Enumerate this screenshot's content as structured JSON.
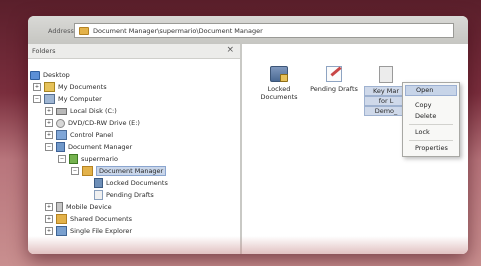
{
  "address_bar": {
    "label": "Address",
    "path": "Document Manager\\supermario\\Document Manager"
  },
  "folders_pane": {
    "title": "Folders",
    "close_glyph": "×"
  },
  "tree": [
    {
      "label": "Desktop",
      "icon": "desktop-icon",
      "expander": ""
    },
    {
      "label": "My Documents",
      "icon": "folder-icon",
      "expander": "+"
    },
    {
      "label": "My Computer",
      "icon": "computer-icon",
      "expander": "−"
    },
    {
      "label": "Local Disk (C:)",
      "icon": "disk-icon",
      "expander": "+"
    },
    {
      "label": "DVD/CD-RW Drive (E:)",
      "icon": "cd-drive-icon",
      "expander": "+"
    },
    {
      "label": "Control Panel",
      "icon": "control-panel-icon",
      "expander": "+"
    },
    {
      "label": "Document Manager",
      "icon": "document-manager-icon",
      "expander": "−"
    },
    {
      "label": "supermario",
      "icon": "user-icon",
      "expander": "−"
    },
    {
      "label": "Document Manager",
      "icon": "folder-icon",
      "expander": "−",
      "selected": true
    },
    {
      "label": "Locked Documents",
      "icon": "locked-documents-icon",
      "expander": ""
    },
    {
      "label": "Pending Drafts",
      "icon": "pending-drafts-icon",
      "expander": ""
    },
    {
      "label": "Mobile Device",
      "icon": "mobile-device-icon",
      "expander": "+"
    },
    {
      "label": "Shared Documents",
      "icon": "folder-icon",
      "expander": "+"
    },
    {
      "label": "Single File Explorer",
      "icon": "single-file-icon",
      "expander": "+"
    }
  ],
  "content": {
    "items": [
      {
        "label_line1": "Locked",
        "label_line2": "Documents",
        "icon": "locked-documents-icon"
      },
      {
        "label_line1": "Pending Drafts",
        "label_line2": "",
        "icon": "pending-drafts-icon"
      },
      {
        "label_line1": "Key Mar",
        "label_line2": "for L",
        "label_line3": "Demo_",
        "icon": "document-icon"
      }
    ]
  },
  "context_menu": {
    "open": "Open",
    "copy": "Copy",
    "delete": "Delete",
    "lock": "Lock",
    "properties": "Properties"
  }
}
